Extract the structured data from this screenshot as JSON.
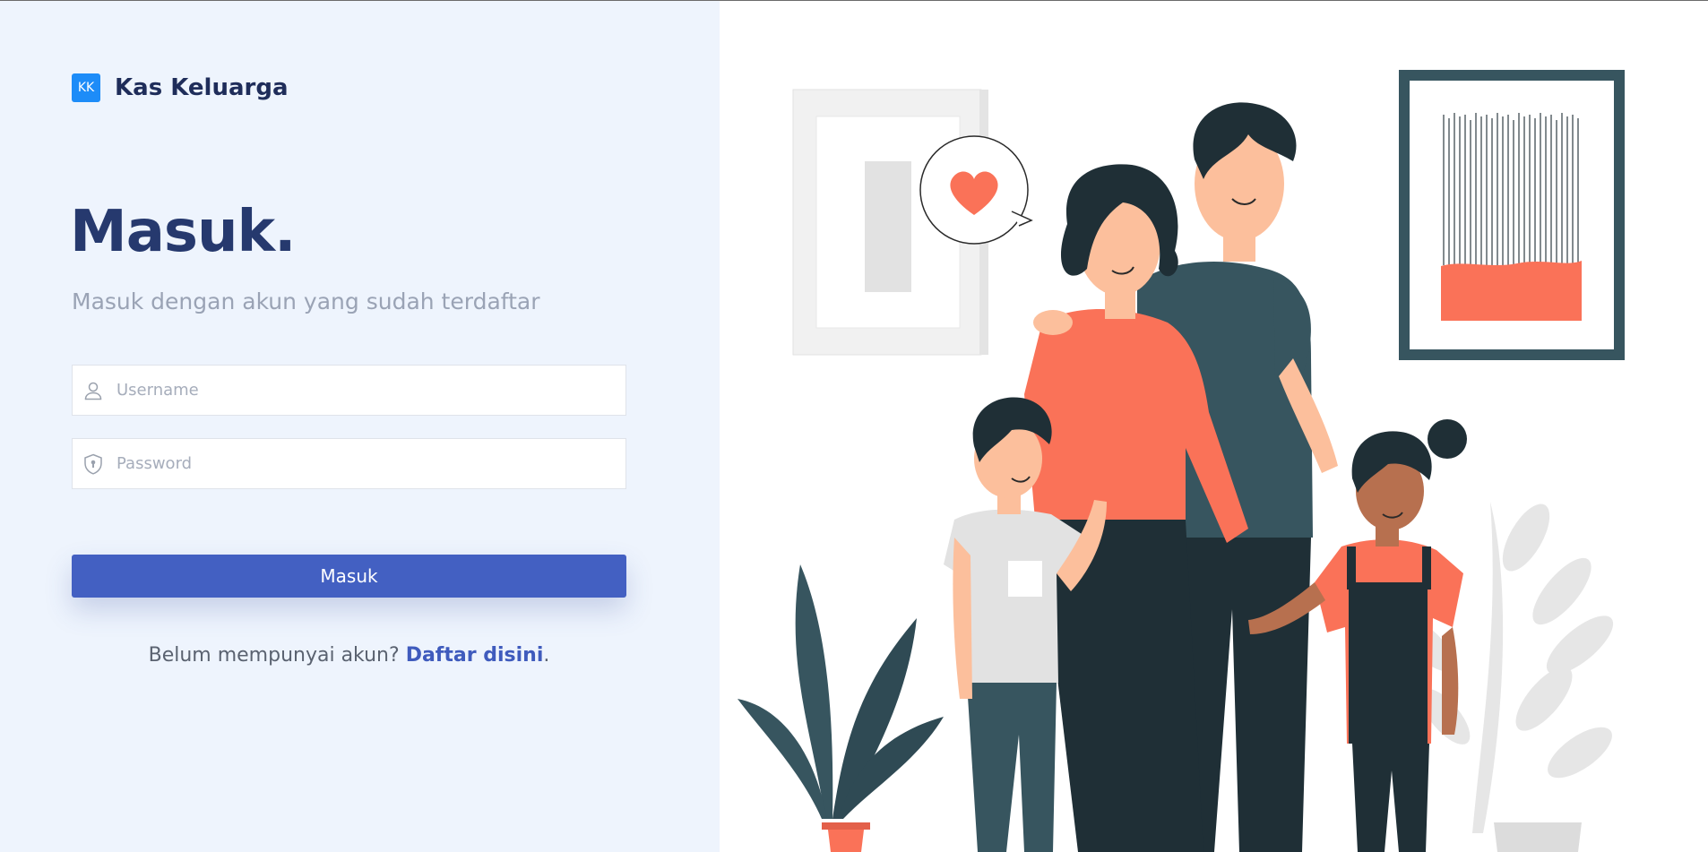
{
  "brand": {
    "logo_text": "KK",
    "name": "Kas Keluarga"
  },
  "login": {
    "title": "Masuk.",
    "subtitle": "Masuk dengan akun yang sudah terdaftar",
    "username_placeholder": "Username",
    "password_placeholder": "Password",
    "submit_label": "Masuk",
    "register_prompt": "Belum mempunyai akun?",
    "register_link": "Daftar disini",
    "register_suffix": "."
  },
  "icons": {
    "username": "user-icon",
    "password": "shield-icon",
    "heart": "heart-icon"
  },
  "colors": {
    "left_background": "#eef4fd",
    "brand_blue": "#1d8cf8",
    "heading": "#26396e",
    "button": "#4360c2",
    "accent_coral": "#fa7258",
    "dark_teal": "#37555f"
  }
}
